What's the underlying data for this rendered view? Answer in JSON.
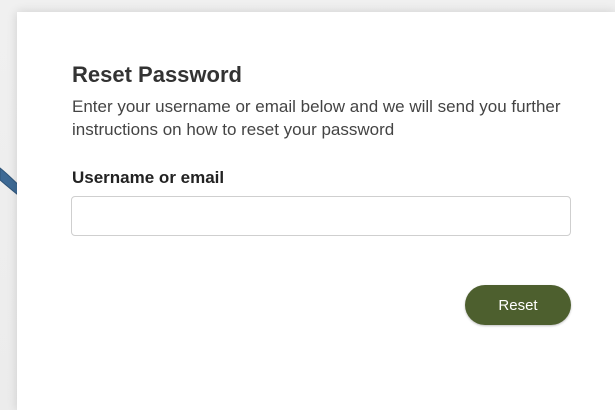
{
  "reset_form": {
    "title": "Reset Password",
    "description": "Enter your username or email below and we will send you further instructions on how to reset your password",
    "username_label": "Username or email",
    "username_value": "",
    "username_placeholder": "",
    "reset_button_label": "Reset"
  },
  "colors": {
    "button_bg": "#4d5f2e",
    "pointer_arrow": "#3e6a95"
  },
  "icons": {
    "pointer": "callout-arrow"
  }
}
